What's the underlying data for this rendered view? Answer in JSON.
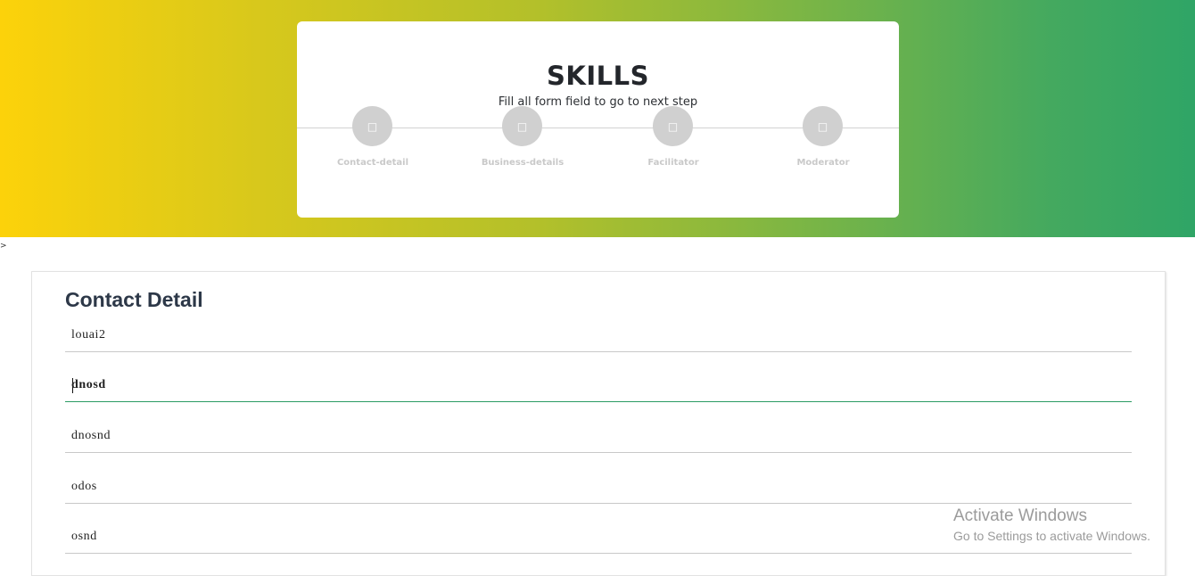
{
  "header": {
    "title": "SKILLS",
    "subtitle": "Fill all form field to go to next step"
  },
  "steps": [
    {
      "label": "Contact-detail",
      "icon": "user-icon",
      "glyph": "□"
    },
    {
      "label": "Business-details",
      "icon": "briefcase-icon",
      "glyph": "□"
    },
    {
      "label": "Facilitator",
      "icon": "person-icon",
      "glyph": "□"
    },
    {
      "label": "Moderator",
      "icon": "shield-icon",
      "glyph": "□"
    }
  ],
  "stray_text": ">",
  "form": {
    "title": "Contact Detail",
    "fields": [
      {
        "value": "louai2"
      },
      {
        "value": "dnosd"
      },
      {
        "value": "dnosnd"
      },
      {
        "value": "odos"
      },
      {
        "value": "osnd"
      }
    ]
  },
  "watermark": {
    "line1": "Activate Windows",
    "line2": "Go to Settings to activate Windows."
  },
  "colors": {
    "gradient_start": "#fcd20a",
    "gradient_end": "#2fa566",
    "active_underline": "#2b9b63",
    "step_inactive": "#d0d0d0"
  }
}
